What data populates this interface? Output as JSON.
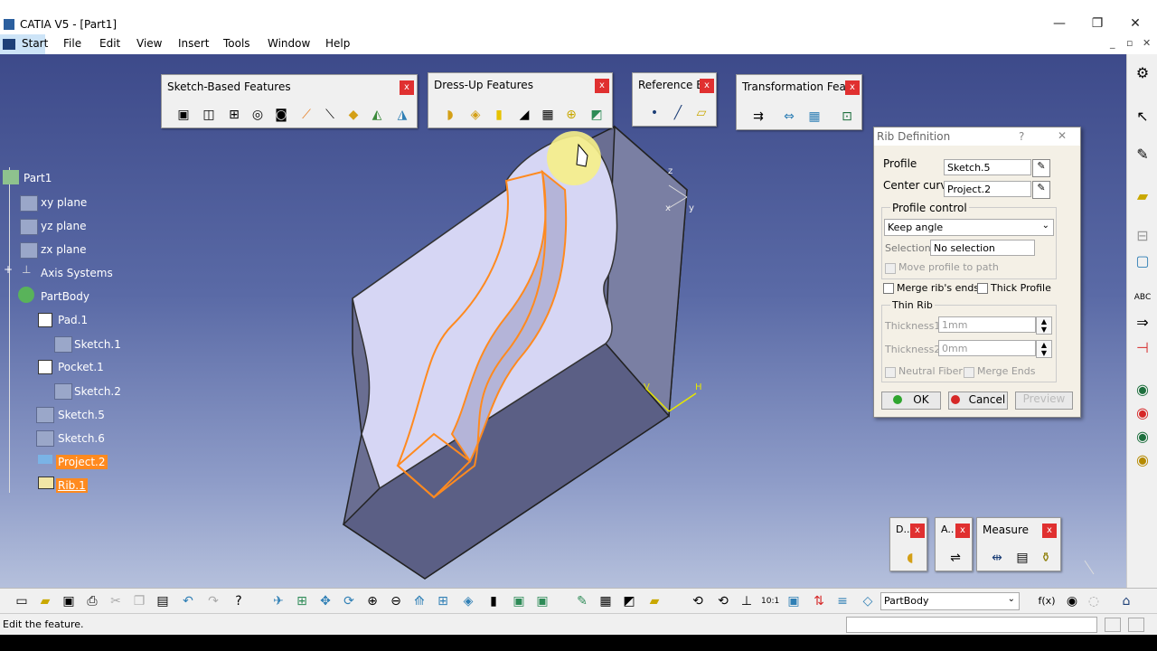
{
  "window": {
    "title": "CATIA V5 - [Part1]",
    "min": "—",
    "restore": "❐",
    "close": "✕"
  },
  "menu": {
    "start": "Start",
    "file": "File",
    "edit": "Edit",
    "view": "View",
    "insert": "Insert",
    "tools": "Tools",
    "window": "Window",
    "help": "Help"
  },
  "toolbars": {
    "sketch_based": {
      "title": "Sketch-Based Features",
      "close": "x"
    },
    "dress_up": {
      "title": "Dress-Up Features",
      "close": "x"
    },
    "reference": {
      "title": "Reference E...",
      "close": "x"
    },
    "transformation": {
      "title": "Transformation Feat...",
      "close": "x"
    },
    "d": {
      "title": "D..",
      "close": "x"
    },
    "a": {
      "title": "A..",
      "close": "x"
    },
    "measure": {
      "title": "Measure",
      "close": "x"
    }
  },
  "tree": {
    "part": "Part1",
    "xy": "xy plane",
    "yz": "yz plane",
    "zx": "zx plane",
    "axis": "Axis Systems",
    "body": "PartBody",
    "pad": "Pad.1",
    "sketch1": "Sketch.1",
    "pocket": "Pocket.1",
    "sketch2": "Sketch.2",
    "sketch5": "Sketch.5",
    "sketch6": "Sketch.6",
    "project2": "Project.2",
    "rib1": "Rib.1"
  },
  "rib_dialog": {
    "title": "Rib Definition",
    "help": "?",
    "close": "✕",
    "profile_label": "Profile",
    "profile_value": "Sketch.5",
    "center_label": "Center curve",
    "center_value": "Project.2",
    "profile_control_label": "Profile control",
    "profile_control_value": "Keep angle",
    "selection_label": "Selection:",
    "selection_value": "No selection",
    "move_profile": "Move profile to path",
    "merge_ends": "Merge rib's ends",
    "thick_profile": "Thick Profile",
    "thin_rib": "Thin Rib",
    "thickness1_label": "Thickness1:",
    "thickness1_value": "1mm",
    "thickness2_label": "Thickness2:",
    "thickness2_value": "0mm",
    "neutral_fiber": "Neutral Fiber",
    "merge_ends2": "Merge Ends",
    "ok": "OK",
    "cancel": "Cancel",
    "preview": "Preview"
  },
  "bottom": {
    "body_select": "PartBody",
    "fx": "f(x)"
  },
  "status": {
    "text": "Edit the feature."
  },
  "axis_labels": {
    "z": "z",
    "x": "x",
    "y": "y",
    "h": "H",
    "v": "V"
  },
  "colors": {
    "highlight": "#ff8a1f",
    "viewport_top": "#3d4a8a",
    "viewport_bottom": "#b5c0dc"
  }
}
